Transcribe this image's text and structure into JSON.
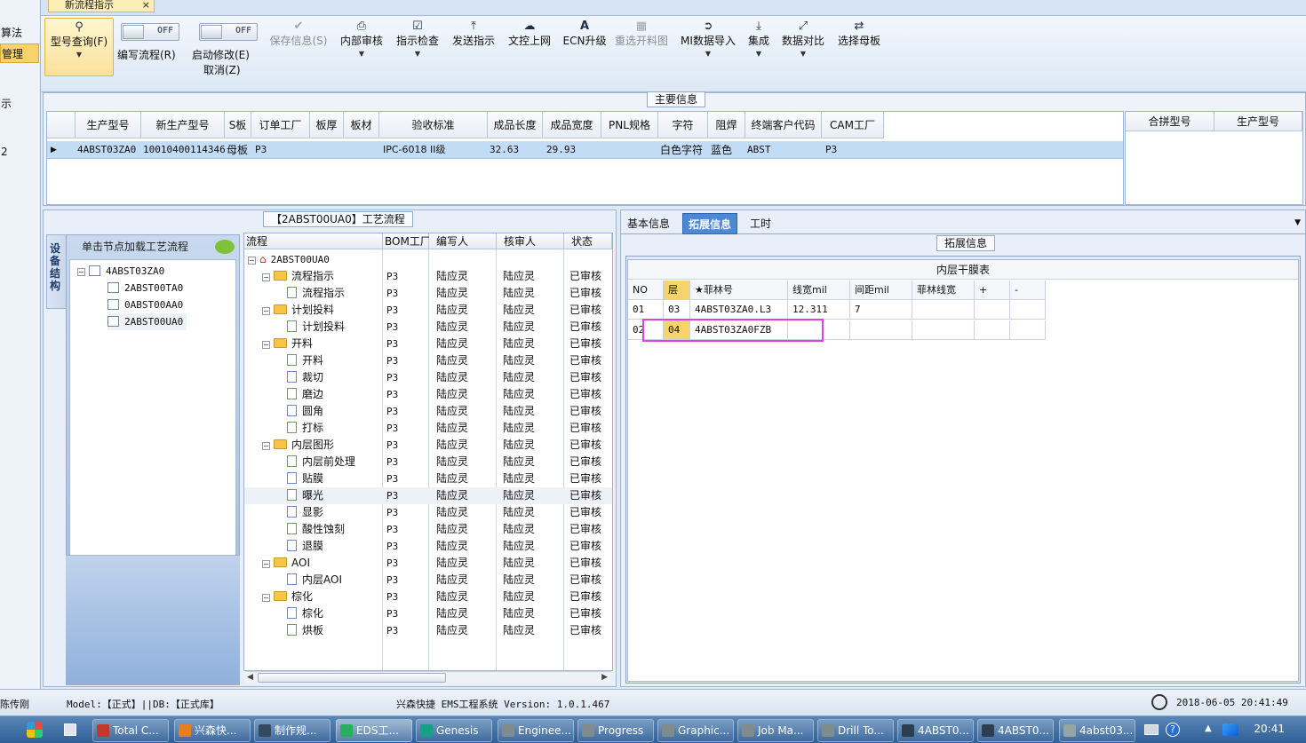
{
  "left_stub": {
    "items": [
      "算法",
      "管理",
      "示",
      "2"
    ]
  },
  "doc_tab": {
    "title": "新流程指示",
    "close": "×"
  },
  "ribbon": {
    "model_query": "型号查询(F)",
    "write_flow_toggle": "OFF",
    "write_flow": "编写流程(R)",
    "enable_edit_toggle": "OFF",
    "enable_edit": "启动修改(E)",
    "cancel": "取消(Z)",
    "save_info": "保存信息(S)",
    "internal_review": "内部审核",
    "instruction_check": "指示检查",
    "send_instruction": "发送指示",
    "doc_upload": "文控上网",
    "ecn_upgrade": "ECN升级",
    "reselect_drawing": "重选开料图",
    "mi_import": "MI数据导入",
    "integrate": "集成",
    "data_compare": "数据对比",
    "select_mother": "选择母板"
  },
  "main_info": {
    "title": "主要信息",
    "columns": [
      "生产型号",
      "新生产型号",
      "S板",
      "订单工厂",
      "板厚",
      "板材",
      "验收标准",
      "成品长度",
      "成品宽度",
      "PNL规格",
      "字符",
      "阻焊",
      "终端客户代码",
      "CAM工厂"
    ],
    "row": [
      "4ABST03ZA0",
      "10010400114346",
      "母板",
      "P3",
      "",
      "",
      "IPC-6018 II级",
      "32.63",
      "29.93",
      "",
      "白色字符",
      "蓝色",
      "ABST",
      "P3"
    ],
    "side_columns": [
      "合拼型号",
      "生产型号"
    ]
  },
  "process": {
    "title": "【2ABST00UA0】工艺流程",
    "vtab": "设备结构",
    "loader_label": "单击节点加载工艺流程",
    "tree1": {
      "root": "4ABST03ZA0",
      "children": [
        "2ABST00TA0",
        "0ABST00AA0",
        "2ABST00UA0"
      ]
    },
    "columns": [
      "流程",
      "BOM工厂",
      "编写人",
      "核审人",
      "状态"
    ],
    "root": "2ABST00UA0",
    "rows": [
      {
        "name": "流程指示",
        "level": 1,
        "folder": true
      },
      {
        "name": "流程指示",
        "level": 2,
        "folder": false
      },
      {
        "name": "计划投料",
        "level": 1,
        "folder": true
      },
      {
        "name": "计划投料",
        "level": 2,
        "folder": false
      },
      {
        "name": "开料",
        "level": 1,
        "folder": true
      },
      {
        "name": "开料",
        "level": 2,
        "folder": false
      },
      {
        "name": "裁切",
        "level": 2,
        "folder": false
      },
      {
        "name": "磨边",
        "level": 2,
        "folder": false
      },
      {
        "name": "圆角",
        "level": 2,
        "folder": false
      },
      {
        "name": "打标",
        "level": 2,
        "folder": false
      },
      {
        "name": "内层图形",
        "level": 1,
        "folder": true
      },
      {
        "name": "内层前处理",
        "level": 2,
        "folder": false
      },
      {
        "name": "贴膜",
        "level": 2,
        "folder": false
      },
      {
        "name": "曝光",
        "level": 2,
        "folder": false
      },
      {
        "name": "显影",
        "level": 2,
        "folder": false
      },
      {
        "name": "酸性蚀刻",
        "level": 2,
        "folder": false
      },
      {
        "name": "退膜",
        "level": 2,
        "folder": false
      },
      {
        "name": "AOI",
        "level": 1,
        "folder": true
      },
      {
        "name": "内层AOI",
        "level": 2,
        "folder": false
      },
      {
        "name": "棕化",
        "level": 1,
        "folder": true
      },
      {
        "name": "棕化",
        "level": 2,
        "folder": false
      },
      {
        "name": "烘板",
        "level": 2,
        "folder": false
      }
    ],
    "bom": "P3",
    "writer": "陆应灵",
    "reviewer": "陆应灵",
    "status": "已审核",
    "selected_index": 13
  },
  "right": {
    "tabs": [
      "基本信息",
      "拓展信息",
      "工时"
    ],
    "active_tab": 1,
    "section_title": "拓展信息",
    "table_title": "内层干膜表",
    "columns": [
      "NO",
      "层",
      "★菲林号",
      "线宽mil",
      "间距mil",
      "菲林线宽",
      "+",
      "-"
    ],
    "rows": [
      [
        "01",
        "03",
        "4ABST03ZA0.L3",
        "12.311",
        "7",
        "",
        "",
        ""
      ],
      [
        "02",
        "04",
        "4ABST03ZA0FZB",
        "",
        "",
        "",
        "",
        ""
      ]
    ]
  },
  "status_bar": {
    "user": "陈传刚",
    "model": "Model:【正式】||DB:【正式库】",
    "system": "兴森快捷 EMS工程系统 Version: 1.0.1.467",
    "datetime": "2018-06-05 20:41:49"
  },
  "taskbar": {
    "items": [
      "Total C...",
      "兴森快...",
      "制作规...",
      "EDS工...",
      "Genesis",
      "Enginee...",
      "Progress",
      "Graphic...",
      "Job Ma...",
      "Drill To...",
      "4ABST0...",
      "4ABST0...",
      "4abst03..."
    ],
    "clock": "20:41"
  },
  "colors": {
    "accent": "#4c88d3",
    "highlight_box": "#e040e0",
    "selected_cell": "#f6d36c",
    "row_select": "#c3dcf5"
  }
}
